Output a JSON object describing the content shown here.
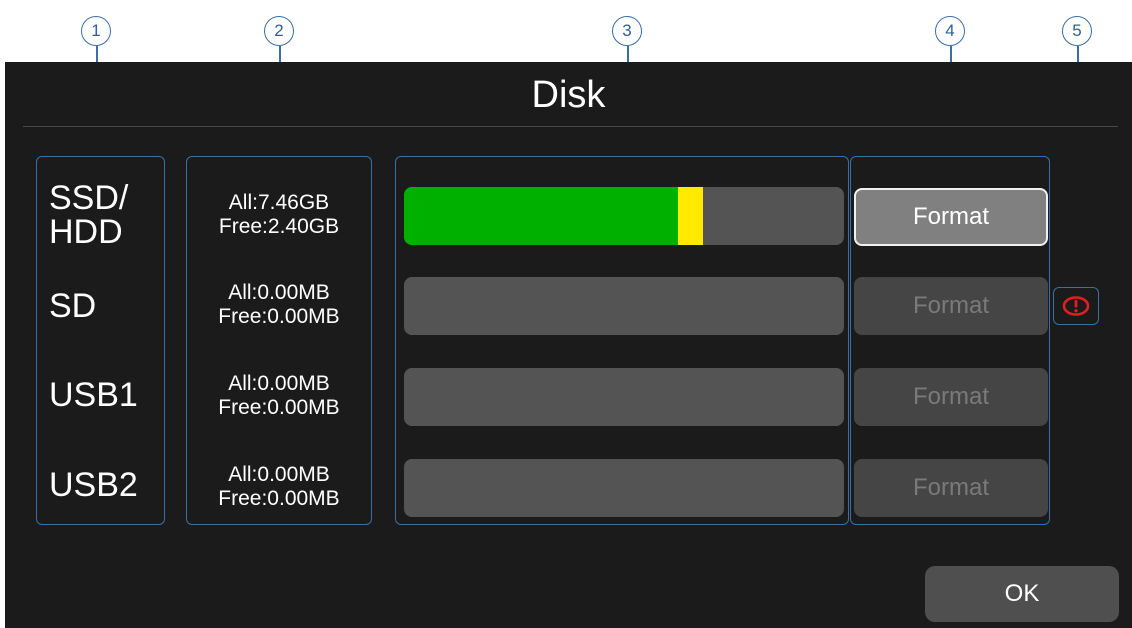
{
  "title": "Disk",
  "callouts": [
    "1",
    "2",
    "3",
    "4",
    "5"
  ],
  "disks": [
    {
      "name_line1": "SSD/",
      "name_line2": "HDD",
      "all": "All:7.46GB",
      "free": "Free:2.40GB",
      "used_fraction": 0.68,
      "format_label": "Format",
      "format_enabled": true
    },
    {
      "name_line1": "SD",
      "name_line2": "",
      "all": "All:0.00MB",
      "free": "Free:0.00MB",
      "used_fraction": 0,
      "format_label": "Format",
      "format_enabled": false
    },
    {
      "name_line1": "USB1",
      "name_line2": "",
      "all": "All:0.00MB",
      "free": "Free:0.00MB",
      "used_fraction": 0,
      "format_label": "Format",
      "format_enabled": false
    },
    {
      "name_line1": "USB2",
      "name_line2": "",
      "all": "All:0.00MB",
      "free": "Free:0.00MB",
      "used_fraction": 0,
      "format_label": "Format",
      "format_enabled": false
    }
  ],
  "status_icon": "warning-icon",
  "ok_label": "OK",
  "colors": {
    "used": "#00b000",
    "tip": "#ffea00",
    "warning": "#e02020"
  }
}
